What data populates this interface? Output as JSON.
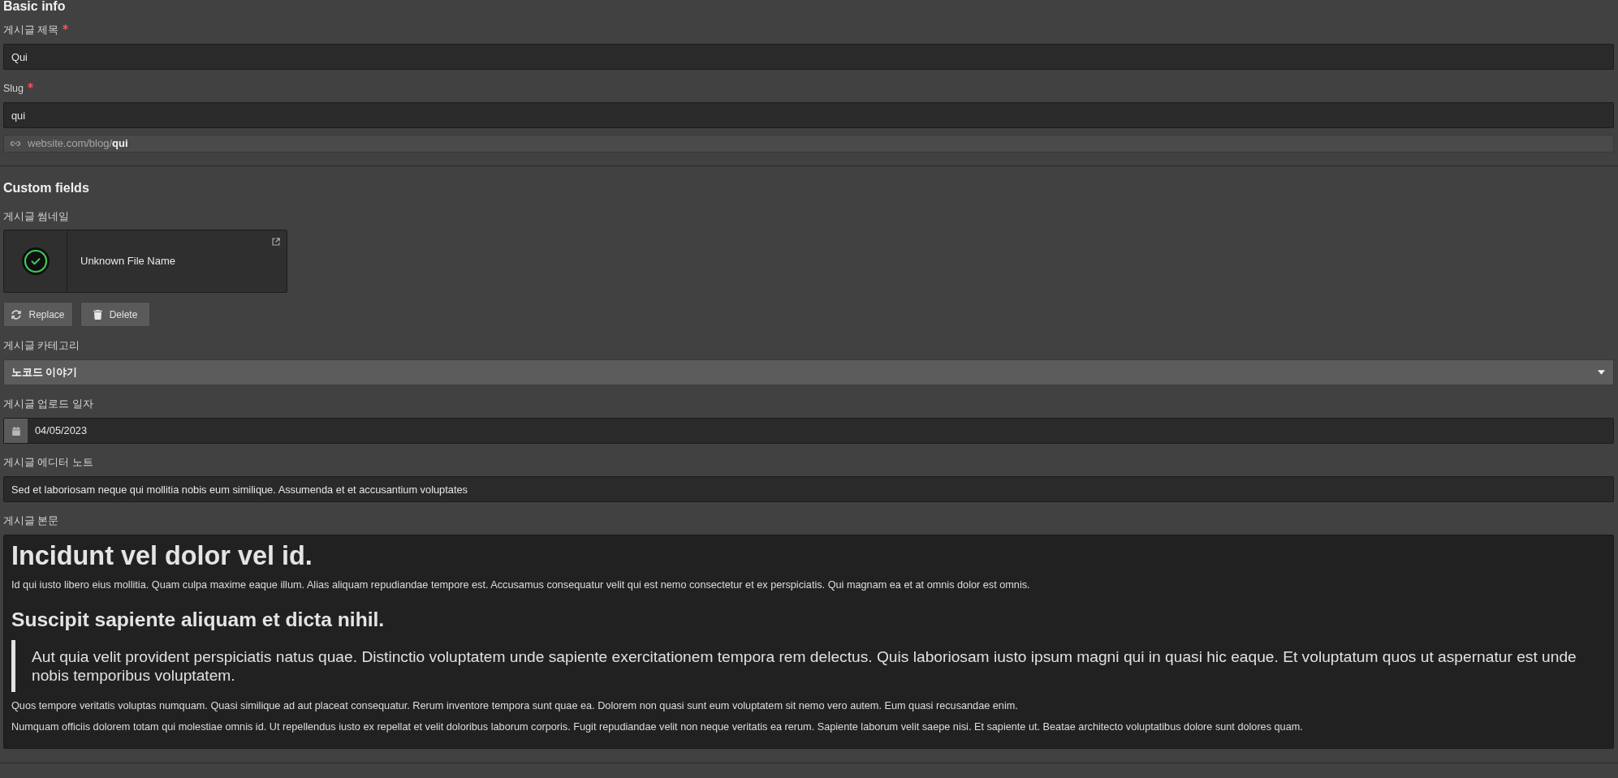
{
  "basic_info": {
    "heading": "Basic info",
    "fields": [
      {
        "label": "게시글 제목",
        "required": true,
        "value": "Qui"
      },
      {
        "label": "Slug",
        "required": true,
        "value": "qui"
      }
    ],
    "url_preview": "website.com/blog/**qui**"
  },
  "custom_fields": {
    "heading": "Custom fields",
    "fields": [
      {
        "kind": "file",
        "label": "게시글 썸네일",
        "file_name": "Unknown File Name",
        "buttons": [
          {
            "kind": "replace",
            "label": "Replace"
          },
          {
            "kind": "delete",
            "label": "Delete"
          }
        ]
      },
      {
        "kind": "select",
        "label": "게시글 카테고리",
        "value": "노코드 이야기"
      },
      {
        "kind": "date",
        "label": "게시글 업로드 일자",
        "value": "04/05/2023"
      },
      {
        "kind": "text",
        "label": "게시글 에디터 노트",
        "value": "Sed et laboriosam neque qui mollitia nobis eum similique. Assumenda et et accusantium voluptates"
      },
      {
        "kind": "richtext",
        "label": "게시글 본문",
        "blocks": [
          {
            "kind": "heading1",
            "text": "Incidunt vel dolor vel id."
          },
          {
            "kind": "paragraph",
            "text": "Id qui iusto libero eius mollitia. Quam culpa maxime eaque illum. Alias aliquam repudiandae tempore est. Accusamus consequatur velit qui est nemo consectetur et ex perspiciatis. Qui magnam ea et at omnis dolor est omnis."
          },
          {
            "kind": "heading2",
            "text": "Suscipit sapiente aliquam et dicta nihil."
          },
          {
            "kind": "quote",
            "text": "Aut quia velit provident perspiciatis natus quae. Distinctio voluptatem unde sapiente exercitationem tempora rem delectus. Quis laboriosam iusto ipsum magni qui in quasi hic eaque. Et voluptatum quos ut aspernatur est unde nobis temporibus voluptatem."
          },
          {
            "kind": "paragraph",
            "text": "Quos tempore veritatis voluptas numquam. Quasi similique ad aut placeat consequatur. Rerum inventore tempora sunt quae ea. Dolorem non quasi sunt eum voluptatem sit nemo vero autem. Eum quasi recusandae enim."
          },
          {
            "kind": "paragraph",
            "text": "Numquam officiis dolorem totam qui molestiae omnis id. Ut repellendus iusto ex repellat et velit doloribus laborum corporis. Fugit repudiandae velit non neque veritatis ea rerum. Sapiente laborum velit saepe nisi. Et sapiente ut. Beatae architecto voluptatibus dolore sunt dolores quam."
          }
        ]
      }
    ]
  }
}
